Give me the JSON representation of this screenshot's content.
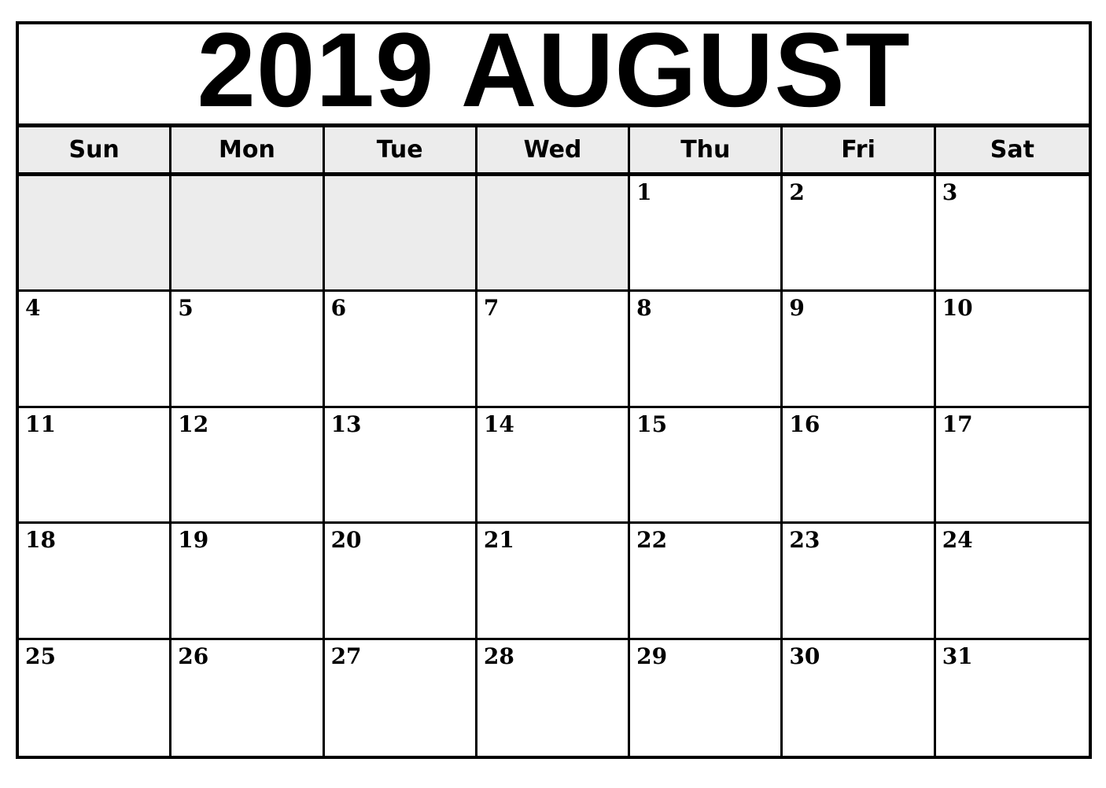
{
  "title": "2019 AUGUST",
  "weekdays": [
    "Sun",
    "Mon",
    "Tue",
    "Wed",
    "Thu",
    "Fri",
    "Sat"
  ],
  "weeks": [
    [
      "",
      "",
      "",
      "",
      "1",
      "2",
      "3"
    ],
    [
      "4",
      "5",
      "6",
      "7",
      "8",
      "9",
      "10"
    ],
    [
      "11",
      "12",
      "13",
      "14",
      "15",
      "16",
      "17"
    ],
    [
      "18",
      "19",
      "20",
      "21",
      "22",
      "23",
      "24"
    ],
    [
      "25",
      "26",
      "27",
      "28",
      "29",
      "30",
      "31"
    ]
  ],
  "colors": {
    "border": "#000000",
    "shade": "#ececec",
    "background": "#ffffff"
  }
}
